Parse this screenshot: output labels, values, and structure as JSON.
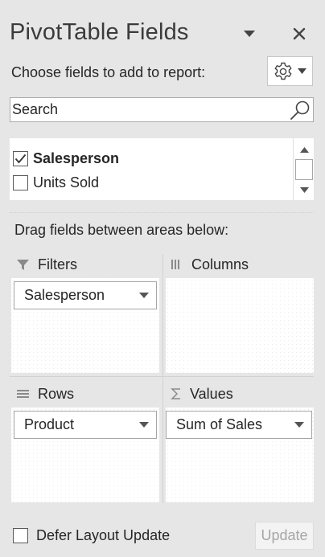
{
  "panel": {
    "title": "PivotTable Fields",
    "choose_label": "Choose fields to add to report:",
    "drag_label": "Drag fields between areas below:"
  },
  "search": {
    "placeholder": "Search",
    "value": ""
  },
  "fields": [
    {
      "label": "Salesperson",
      "checked": true,
      "bold": true
    },
    {
      "label": "Units Sold",
      "checked": false,
      "bold": false
    }
  ],
  "areas": {
    "filters": {
      "label": "Filters",
      "icon": "filter-icon",
      "items": [
        "Salesperson"
      ]
    },
    "columns": {
      "label": "Columns",
      "icon": "columns-icon",
      "items": []
    },
    "rows": {
      "label": "Rows",
      "icon": "rows-icon",
      "items": [
        "Product"
      ]
    },
    "values": {
      "label": "Values",
      "icon": "sigma-icon",
      "items": [
        "Sum of Sales"
      ]
    }
  },
  "footer": {
    "defer_label": "Defer Layout Update",
    "defer_checked": false,
    "update_label": "Update",
    "update_enabled": false
  },
  "colors": {
    "panel_bg": "#e6e6e6",
    "text": "#262626",
    "disabled_text": "#a6a6a6"
  }
}
